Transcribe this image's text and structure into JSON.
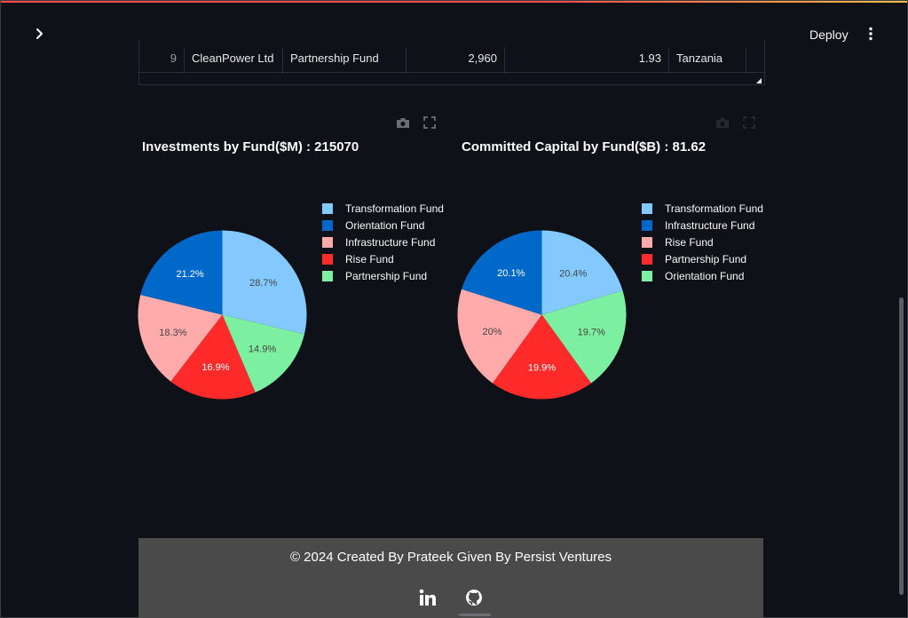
{
  "header": {
    "deploy_label": "Deploy"
  },
  "icons": {
    "sidebar_toggle": "chevron-right-icon",
    "menu": "vertical-dots-icon",
    "camera": "camera-icon",
    "fullscreen": "fullscreen-icon",
    "linkedin": "linkedin-icon",
    "github": "github-icon"
  },
  "table": {
    "row": {
      "index": "9",
      "company": "CleanPower Ltd",
      "fund": "Partnership Fund",
      "investment": "2,960",
      "capital": "1.93",
      "country": "Tanzania"
    }
  },
  "chart_data": [
    {
      "type": "pie",
      "title": "Investments by Fund($M) : 215070",
      "legend_position": "right",
      "legend": [
        "Transformation Fund",
        "Orientation Fund",
        "Infrastructure Fund",
        "Rise Fund",
        "Partnership Fund"
      ],
      "slices": [
        {
          "name": "Transformation Fund",
          "value": 28.7,
          "label": "28.7%",
          "color": "#83c9ff"
        },
        {
          "name": "Partnership Fund",
          "value": 14.9,
          "label": "14.9%",
          "color": "#7defa1"
        },
        {
          "name": "Rise Fund",
          "value": 16.9,
          "label": "16.9%",
          "color": "#ff2b2b"
        },
        {
          "name": "Infrastructure Fund",
          "value": 18.3,
          "label": "18.3%",
          "color": "#ffabab"
        },
        {
          "name": "Orientation Fund",
          "value": 21.2,
          "label": "21.2%",
          "color": "#0068c9"
        }
      ]
    },
    {
      "type": "pie",
      "title": "Committed Capital by Fund($B) : 81.62",
      "legend_position": "right",
      "legend": [
        "Transformation Fund",
        "Infrastructure Fund",
        "Rise Fund",
        "Partnership Fund",
        "Orientation Fund"
      ],
      "slices": [
        {
          "name": "Transformation Fund",
          "value": 20.4,
          "label": "20.4%",
          "color": "#83c9ff"
        },
        {
          "name": "Orientation Fund",
          "value": 19.7,
          "label": "19.7%",
          "color": "#7defa1"
        },
        {
          "name": "Partnership Fund",
          "value": 19.9,
          "label": "19.9%",
          "color": "#ff2b2b"
        },
        {
          "name": "Rise Fund",
          "value": 20,
          "label": "20%",
          "color": "#ffabab"
        },
        {
          "name": "Infrastructure Fund",
          "value": 20.1,
          "label": "20.1%",
          "color": "#0068c9"
        }
      ]
    }
  ],
  "footer": {
    "text": "© 2024 Created By Prateek Given By Persist Ventures"
  }
}
